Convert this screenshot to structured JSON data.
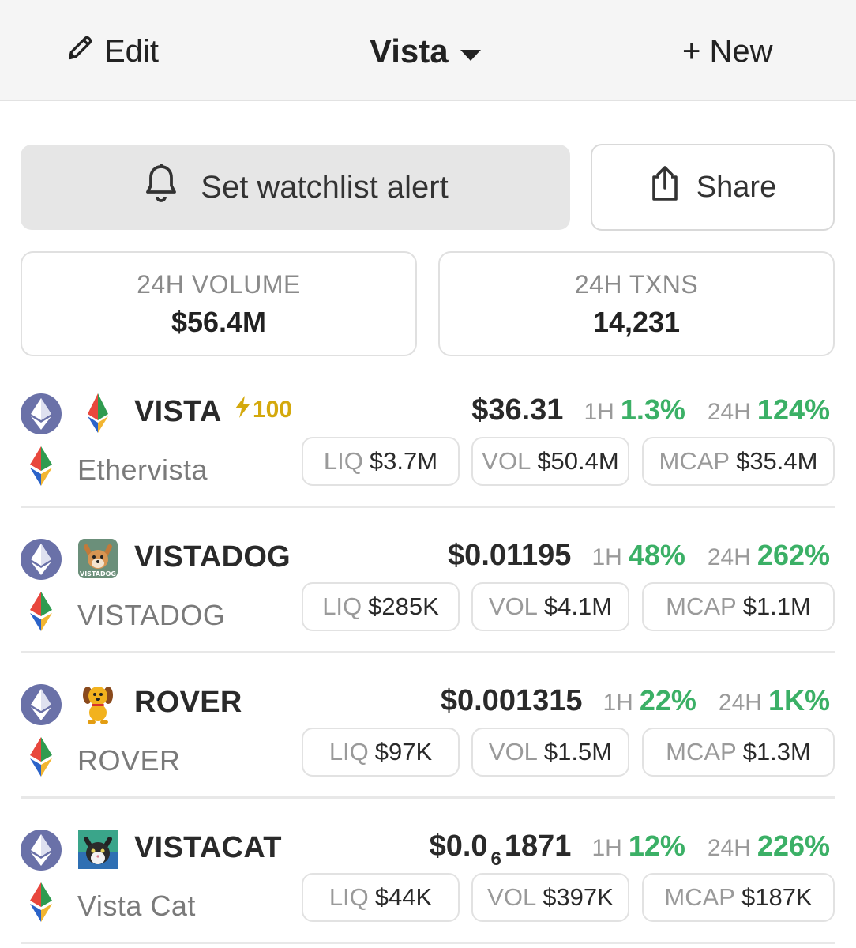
{
  "header": {
    "edit_label": "Edit",
    "title": "Vista",
    "new_label": "+ New"
  },
  "actions": {
    "alert_label": "Set watchlist alert",
    "share_label": "Share"
  },
  "stats": {
    "volume_label": "24H VOLUME",
    "volume_value": "$56.4M",
    "txns_label": "24H TXNS",
    "txns_value": "14,231"
  },
  "tokens": [
    {
      "symbol": "VISTA",
      "boost": "100",
      "name": "Ethervista",
      "price": "$36.31",
      "h1_label": "1H",
      "h1": "1.3%",
      "h24_label": "24H",
      "h24": "124%",
      "liq_label": "LIQ",
      "liq": "$3.7M",
      "vol_label": "VOL",
      "vol": "$50.4M",
      "mcap_label": "MCAP",
      "mcap": "$35.4M"
    },
    {
      "symbol": "VISTADOG",
      "name": "VISTADOG",
      "logo_text": "VISTADOG",
      "price": "$0.01195",
      "h1_label": "1H",
      "h1": "48%",
      "h24_label": "24H",
      "h24": "262%",
      "liq_label": "LIQ",
      "liq": "$285K",
      "vol_label": "VOL",
      "vol": "$4.1M",
      "mcap_label": "MCAP",
      "mcap": "$1.1M"
    },
    {
      "symbol": "ROVER",
      "name": "ROVER",
      "price": "$0.001315",
      "h1_label": "1H",
      "h1": "22%",
      "h24_label": "24H",
      "h24": "1K%",
      "liq_label": "LIQ",
      "liq": "$97K",
      "vol_label": "VOL",
      "vol": "$1.5M",
      "mcap_label": "MCAP",
      "mcap": "$1.3M"
    },
    {
      "symbol": "VISTACAT",
      "name": "Vista Cat",
      "price_prefix": "$0.0",
      "price_zeros": "6",
      "price_digits": "1871",
      "h1_label": "1H",
      "h1": "12%",
      "h24_label": "24H",
      "h24": "226%",
      "liq_label": "LIQ",
      "liq": "$44K",
      "vol_label": "VOL",
      "vol": "$397K",
      "mcap_label": "MCAP",
      "mcap": "$187K"
    }
  ],
  "colors": {
    "positive": "#3bb066",
    "boost": "#d4a90d",
    "chain_circle": "#6a71a8"
  },
  "icons": {
    "edit": "pencil-icon",
    "dropdown": "caret-down-icon",
    "alert": "bell-icon",
    "share": "share-icon",
    "boost": "lightning-icon",
    "chain": "ethereum-icon"
  }
}
